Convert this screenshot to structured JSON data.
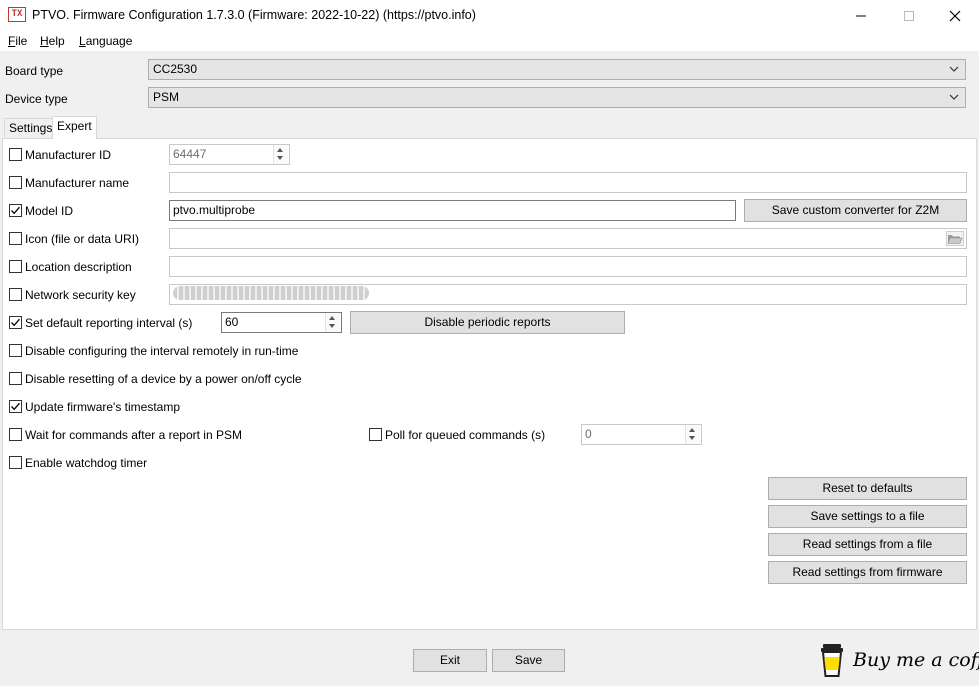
{
  "window": {
    "title": "PTVO. Firmware Configuration 1.7.3.0 (Firmware: 2022-10-22) (https://ptvo.info)",
    "icon_text": "TX"
  },
  "menu": [
    {
      "label": "File"
    },
    {
      "label": "Help"
    },
    {
      "label": "Language"
    }
  ],
  "board_type": {
    "label": "Board type",
    "value": "CC2530"
  },
  "device_type": {
    "label": "Device type",
    "value": "PSM"
  },
  "tabs": [
    {
      "label": "Settings",
      "active": false
    },
    {
      "label": "Expert",
      "active": true
    }
  ],
  "expert": {
    "manufacturer_id": {
      "label": "Manufacturer ID",
      "checked": false,
      "value": "64447"
    },
    "manufacturer_name": {
      "label": "Manufacturer name",
      "checked": false,
      "value": ""
    },
    "model_id": {
      "label": "Model ID",
      "checked": true,
      "value": "ptvo.multiprobe"
    },
    "save_converter_button": "Save custom converter for Z2M",
    "icon": {
      "label": "Icon (file or data URI)",
      "checked": false,
      "value": ""
    },
    "location_description": {
      "label": "Location description",
      "checked": false,
      "value": ""
    },
    "network_security_key": {
      "label": "Network security key",
      "checked": false
    },
    "default_reporting_interval": {
      "label": "Set default reporting interval (s)",
      "checked": true,
      "value": "60"
    },
    "disable_periodic_reports_button": "Disable periodic reports",
    "disable_interval_config": {
      "label": "Disable configuring the interval remotely in run-time",
      "checked": false
    },
    "disable_power_reset": {
      "label": "Disable resetting of a device by a power on/off cycle",
      "checked": false
    },
    "update_timestamp": {
      "label": "Update firmware's timestamp",
      "checked": true
    },
    "wait_for_commands": {
      "label": "Wait for commands after a report in PSM",
      "checked": false
    },
    "poll_queued": {
      "label": "Poll for queued commands (s)",
      "checked": false,
      "value": "0"
    },
    "watchdog": {
      "label": "Enable watchdog timer",
      "checked": false
    }
  },
  "side_buttons": {
    "reset": "Reset to defaults",
    "save_file": "Save settings to a file",
    "read_file": "Read settings from a file",
    "read_firmware": "Read settings from firmware"
  },
  "footer": {
    "exit": "Exit",
    "save": "Save",
    "coffee": "Buy me a coffee"
  }
}
